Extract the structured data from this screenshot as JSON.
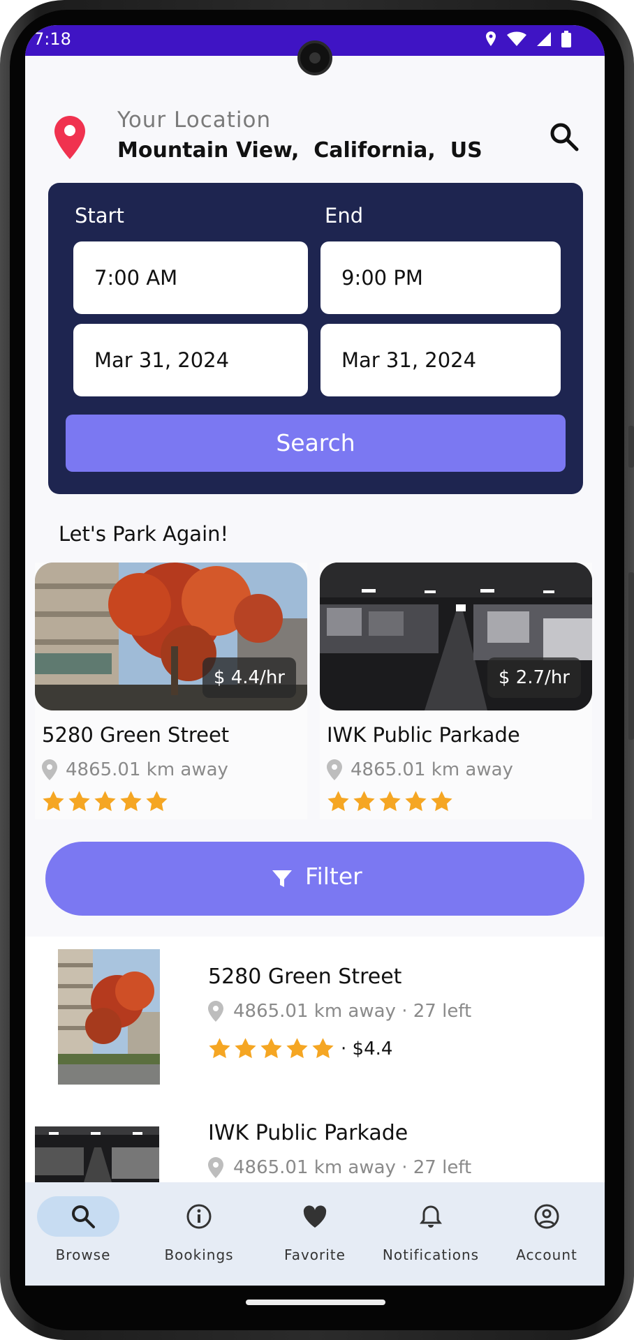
{
  "status_bar": {
    "time": "7:18"
  },
  "header": {
    "location_label": "Your Location",
    "location_value": "Mountain View,  California,  US"
  },
  "time_picker": {
    "start_label": "Start",
    "end_label": "End",
    "start_time": "7:00 AM",
    "end_time": "9:00 PM",
    "start_date": "Mar 31, 2024",
    "end_date": "Mar 31, 2024",
    "search_label": "Search"
  },
  "recent": {
    "title": "Let's Park Again!",
    "cards": [
      {
        "name": "5280 Green Street",
        "distance": "4865.01 km away",
        "price": "$ 4.4/hr",
        "rating": 5
      },
      {
        "name": "IWK Public Parkade",
        "distance": "4865.01 km away",
        "price": "$ 2.7/hr",
        "rating": 5
      }
    ]
  },
  "filter": {
    "label": "Filter"
  },
  "listings": [
    {
      "name": "5280 Green Street",
      "meta": "4865.01 km away · 27 left",
      "price": "· $4.4",
      "rating": 5
    },
    {
      "name": "IWK Public Parkade",
      "meta": "4865.01 km away · 27 left"
    }
  ],
  "nav": {
    "items": [
      {
        "label": "Browse",
        "icon": "search-icon",
        "active": true
      },
      {
        "label": "Bookings",
        "icon": "info-icon"
      },
      {
        "label": "Favorite",
        "icon": "heart-icon"
      },
      {
        "label": "Notifications",
        "icon": "bell-icon"
      },
      {
        "label": "Account",
        "icon": "account-icon"
      }
    ]
  },
  "colors": {
    "status_bar": "#3f14c4",
    "accent": "#7b78f2",
    "card_dark": "#1e2550",
    "star": "#f5a623",
    "pin": "#f0324f",
    "nav_bg": "#e6ecf5"
  }
}
